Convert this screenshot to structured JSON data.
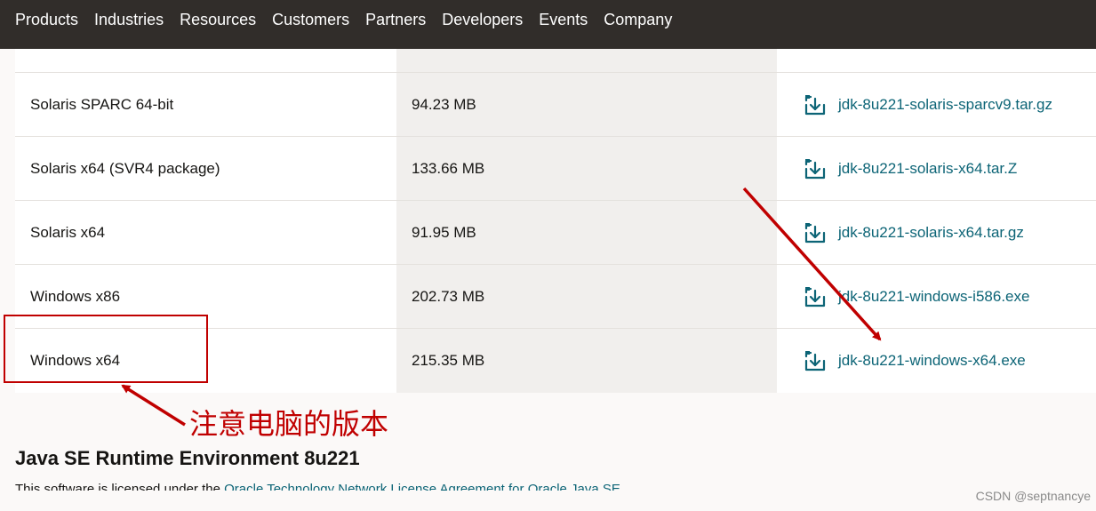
{
  "nav": {
    "items": [
      "Products",
      "Industries",
      "Resources",
      "Customers",
      "Partners",
      "Developers",
      "Events",
      "Company"
    ]
  },
  "table": {
    "rows": [
      {
        "label": "Solaris SPARC 64-bit",
        "size": "94.23 MB",
        "file": "jdk-8u221-solaris-sparcv9.tar.gz"
      },
      {
        "label": "Solaris x64 (SVR4 package)",
        "size": "133.66 MB",
        "file": "jdk-8u221-solaris-x64.tar.Z"
      },
      {
        "label": "Solaris x64",
        "size": "91.95 MB",
        "file": "jdk-8u221-solaris-x64.tar.gz"
      },
      {
        "label": "Windows x86",
        "size": "202.73 MB",
        "file": "jdk-8u221-windows-i586.exe"
      },
      {
        "label": "Windows x64",
        "size": "215.35 MB",
        "file": "jdk-8u221-windows-x64.exe"
      }
    ]
  },
  "annotation": {
    "text": "注意电脑的版本",
    "color": "#c00000"
  },
  "section": {
    "title": "Java SE Runtime Environment 8u221",
    "license_prefix": "This software is licensed under the ",
    "license_link": "Oracle Technology Network License Agreement for Oracle Java SE"
  },
  "watermark": "CSDN @septnancye",
  "colors": {
    "nav_bg": "#312d2a",
    "link": "#0c6476",
    "size_column_bg": "#f1efed"
  }
}
